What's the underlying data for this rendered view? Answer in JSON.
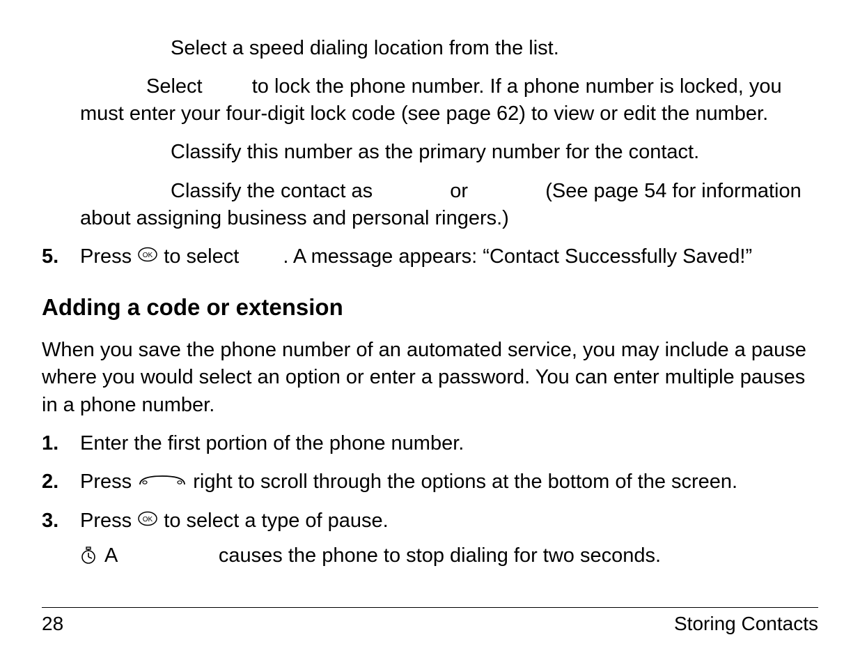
{
  "top_block": {
    "speed_dial": "Select a speed dialing location from the list.",
    "secret_lead": "Select",
    "secret_rest": "to lock the phone number. If a phone number is locked, you must enter your four-digit lock code (see page 62) to view or edit the number.",
    "primary_lead": "Classify this number as the primary number for the contact.",
    "classify_a": "Classify the contact as",
    "classify_b": "or",
    "classify_c": "(See page 54 for information about assigning business and personal ringers.)"
  },
  "step5": {
    "num": "5.",
    "a": "Press",
    "b": "to select",
    "c": ". A message appears: “Contact Successfully Saved!”"
  },
  "heading": "Adding a code or extension",
  "intro": "When you save the phone number of an automated service, you may include a pause where you would select an option or enter a password. You can enter multiple pauses in a phone number.",
  "step1": {
    "num": "1.",
    "text": "Enter the first portion of the phone number."
  },
  "step2": {
    "num": "2.",
    "a": "Press",
    "b": "right to scroll through the options at the bottom of the screen."
  },
  "step3": {
    "num": "3.",
    "a": "Press",
    "b": "to select a type of pause."
  },
  "pause_bullet": {
    "a": "A",
    "b": "causes the phone to stop dialing for two seconds."
  },
  "footer": {
    "page": "28",
    "section": "Storing Contacts"
  }
}
